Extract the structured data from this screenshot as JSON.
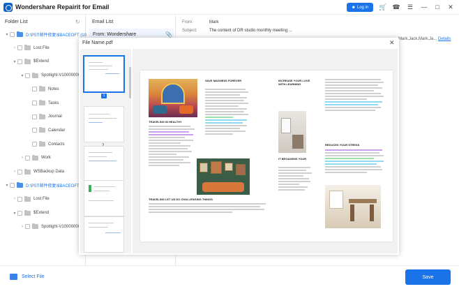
{
  "app": {
    "title": "Wondershare Repairit for Email",
    "login_label": "Log in"
  },
  "sidebar": {
    "title": "Folder List",
    "tree": [
      {
        "label": "D:\\PST邮件修复\\$BACEOFT (10)",
        "level": 0,
        "expanded": true,
        "folder_color": "blue"
      },
      {
        "label": "Lost File",
        "level": 1,
        "expanded": false
      },
      {
        "label": "$Extend",
        "level": 1,
        "expanded": true
      },
      {
        "label": "Spotlight-V100000000...",
        "level": 2,
        "expanded": true
      },
      {
        "label": "Notes",
        "level": 3
      },
      {
        "label": "Tasks",
        "level": 3
      },
      {
        "label": "Journal",
        "level": 3
      },
      {
        "label": "Calendar",
        "level": 3
      },
      {
        "label": "Contacts",
        "level": 3
      },
      {
        "label": "Work",
        "level": 2,
        "expanded": false
      },
      {
        "label": "WSBackup Data",
        "level": 1,
        "expanded": false
      },
      {
        "label": "D:\\PST邮件修复\\$BACEOFT (10)",
        "level": 0,
        "expanded": true,
        "folder_color": "blue"
      },
      {
        "label": "Lost File",
        "level": 1,
        "expanded": false
      },
      {
        "label": "$Extend",
        "level": 1,
        "expanded": true
      },
      {
        "label": "Spotlight-V100000000...",
        "level": 2,
        "expanded": false
      }
    ]
  },
  "email_list": {
    "title": "Email List",
    "items": [
      {
        "from": "From: Wondershare"
      }
    ]
  },
  "email_header": {
    "from_label": "From:",
    "from_value": "Mark",
    "subject_label": "Subject:",
    "subject_value": "The content of DR studio monthly meeting ...",
    "to_value": "Mark,Jack,Mark,Ja...",
    "details_label": "Details"
  },
  "preview": {
    "file_name": "File Name.pdf",
    "pages": [
      "1",
      "2",
      "3",
      "4",
      "5"
    ],
    "selected_page": "1",
    "document": {
      "heading_1": "TRAVELING IN HEALTHY",
      "heading_2": "SAVE MADNESS FOREVER",
      "heading_3": "INCREASE YOUR LOVE WITH LEARNING",
      "heading_4": "REDUCES YOUR STRESS",
      "heading_5": "IT BROADENS YOUR",
      "heading_6": "TRAVELING LET US DO CHALLENGING THINGS"
    }
  },
  "footer": {
    "select_file_label": "Select File",
    "save_label": "Save"
  },
  "colors": {
    "accent": "#1a73e8",
    "highlight_purple": "#c9a0f0",
    "highlight_green": "#9fe0a8",
    "highlight_cyan": "#8fd9f2"
  }
}
